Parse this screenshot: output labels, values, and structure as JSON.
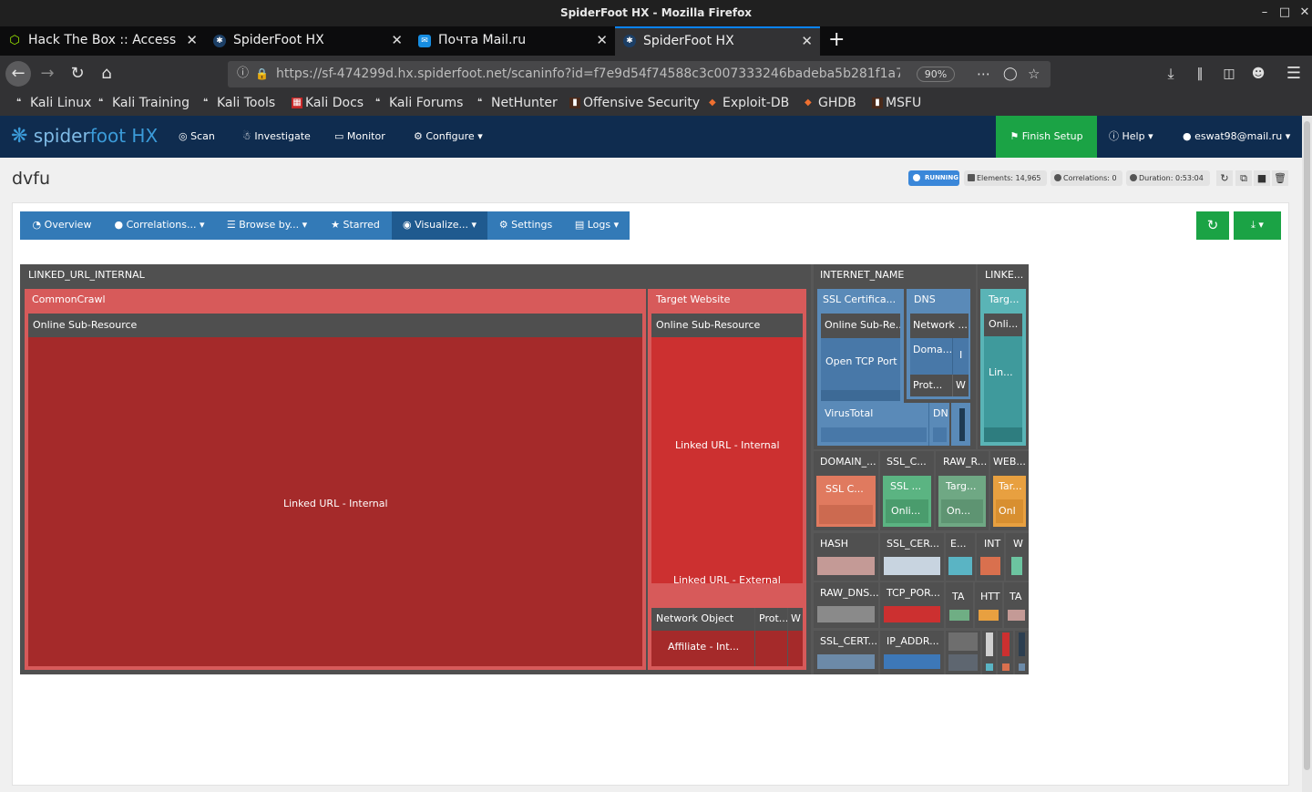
{
  "window": {
    "title": "SpiderFoot HX - Mozilla Firefox"
  },
  "tabs": [
    {
      "label": "Hack The Box :: Access"
    },
    {
      "label": "SpiderFoot HX"
    },
    {
      "label": "Почта Mail.ru"
    },
    {
      "label": "SpiderFoot HX"
    }
  ],
  "browser": {
    "url": "https://sf-474299d.hx.spiderfoot.net/scaninfo?id=f7e9d54f74588c3c007333246badeba5b281f1a766",
    "zoom": "90%"
  },
  "bookmarks": [
    "Kali Linux",
    "Kali Training",
    "Kali Tools",
    "Kali Docs",
    "Kali Forums",
    "NetHunter",
    "Offensive Security",
    "Exploit-DB",
    "GHDB",
    "MSFU"
  ],
  "app": {
    "logo_a": "spider",
    "logo_b": "foot",
    "logo_c": "HX",
    "nav": {
      "scan": "Scan",
      "investigate": "Investigate",
      "monitor": "Monitor",
      "configure": "Configure"
    },
    "finish_setup": "Finish Setup",
    "help": "Help",
    "user": "eswat98@mail.ru"
  },
  "scan": {
    "name": "dvfu",
    "status": "RUNNING",
    "elements": "Elements: 14,965",
    "correlations": "Correlations: 0",
    "duration": "Duration: 0:53:04"
  },
  "toolbar": {
    "overview": "Overview",
    "correlations": "Correlations...",
    "browse": "Browse by...",
    "starred": "Starred",
    "visualize": "Visualize...",
    "settings": "Settings",
    "logs": "Logs"
  },
  "treemap": {
    "linked_url_internal": "LINKED_URL_INTERNAL",
    "commoncrawl": "CommonCrawl",
    "online_sub_resource": "Online Sub-Resource",
    "linked_url_internal_label": "Linked URL - Internal",
    "target_website": "Target Website",
    "online_sub_resource_2": "Online Sub-Resource",
    "linked_url_internal_2": "Linked URL - Internal",
    "linked_url_external": "Linked URL - External",
    "network_object": "Network Object",
    "prot": "Prot...",
    "w": "W",
    "affiliate": "Affiliate - Int...",
    "internet_name": "INTERNET_NAME",
    "linke": "LINKE...",
    "ssl_certifica": "SSL Certifica...",
    "dns": "DNS",
    "online_sub_re": "Online Sub-Re...",
    "network_dots": "Network ...",
    "open_tcp_port": "Open TCP Port",
    "doma": "Doma...",
    "i": "I",
    "prot2": "Prot...",
    "w2": "W",
    "virustotal": "VirusTotal",
    "dn": "DN",
    "targ": "Targ...",
    "onli": "Onli...",
    "lin": "Lin...",
    "domain_": "DOMAIN_...",
    "ssl_c": "SSL_C...",
    "raw_r": "RAW_R...",
    "web": "WEB...",
    "ssl_c2": "SSL C...",
    "ssl_dots": "SSL ...",
    "onli2": "Onli...",
    "targ2": "Targ...",
    "on": "On...",
    "tar": "Tar...",
    "onl": "Onl",
    "hash": "HASH",
    "ssl_cer": "SSL_CER...",
    "e": "E...",
    "int": "INT",
    "w3": "W",
    "raw_dns": "RAW_DNS...",
    "tcp_por": "TCP_POR...",
    "ta": "TA",
    "htt": "HTT",
    "ta2": "TA",
    "ssl_cert": "SSL_CERT...",
    "ip_addr": "IP_ADDR..."
  }
}
